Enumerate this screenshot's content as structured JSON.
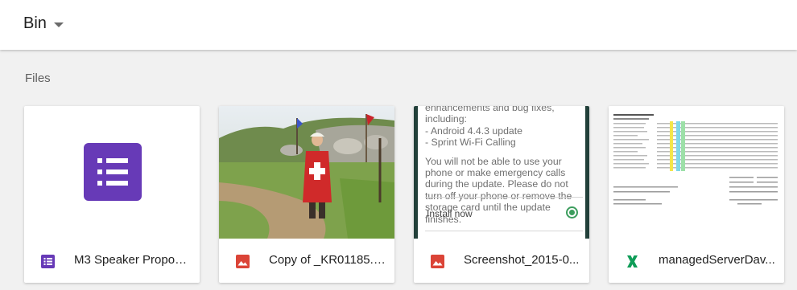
{
  "header": {
    "title": "Bin"
  },
  "section": {
    "label": "Files"
  },
  "files": [
    {
      "name": "M3 Speaker Proposals",
      "type_icon": "forms-icon",
      "color": "#673ab7"
    },
    {
      "name": "Copy of _KR01185.JPG",
      "type_icon": "image-icon",
      "color": "#db4437"
    },
    {
      "name": "Screenshot_2015-0...",
      "type_icon": "image-icon",
      "color": "#db4437",
      "preview": {
        "text_lines": [
          "enhancements and bug fixes, including:",
          "- Android 4.4.3 update",
          "- Sprint Wi-Fi Calling",
          "You will not be able to use your phone or make emergency calls during the update. Please do not turn off your phone or remove the storage card until the update finishes."
        ],
        "action": "Install now"
      }
    },
    {
      "name": "managedServerDav...",
      "type_icon": "sheets-x-icon",
      "color": "#0f9d58"
    }
  ]
}
